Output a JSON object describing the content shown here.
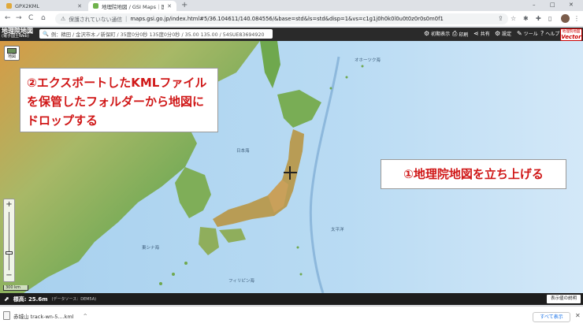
{
  "browser": {
    "tabs": [
      {
        "title": "GPX2KML",
        "active": false
      },
      {
        "title": "地理院地図 / GSI Maps｜国土地",
        "active": true
      }
    ],
    "new_tab": "+",
    "window_controls": {
      "minimize": "–",
      "restore": "□",
      "close": "✕"
    },
    "nav": {
      "back": "←",
      "forward": "→",
      "reload": "C",
      "home": "⌂"
    },
    "address": {
      "insecure_label": "保護されていない通信",
      "url": "maps.gsi.go.jp/index.html#5/36.104611/140.084556/&base=std&ls=std&disp=1&vs=c1g1j0h0k0l0u0t0z0r0s0m0f1"
    }
  },
  "app": {
    "logo_main": "地理院地図",
    "logo_sub": "(電子国土Web)",
    "search_placeholder": "例：精田 / 金沢市木ノ新保町 / 35度0分0秒 135度0分0秒 / 35.00 135.00 / 54SUE83694920",
    "header_buttons": [
      {
        "icon": "gear",
        "label": "初期表示"
      },
      {
        "icon": "printer",
        "label": "印刷"
      },
      {
        "icon": "share",
        "label": "共有"
      },
      {
        "icon": "gear",
        "label": "設定"
      },
      {
        "icon": "wrench",
        "label": "ツール"
      },
      {
        "icon": "help",
        "label": "ヘルプ"
      }
    ],
    "vector_badge": {
      "top": "地理院地図",
      "bottom": "Vector"
    },
    "layer_button": "地図"
  },
  "map": {
    "sea_labels": [
      "日本海",
      "太平洋",
      "東シナ海",
      "オホーツク海",
      "フィリピン海"
    ],
    "scale_label": "300 km",
    "zoom_in": "+",
    "zoom_out": "−"
  },
  "callouts": {
    "kml": "②エクスポートしたKMLファイルを保管したフォルダーから地図にドロップする",
    "launch": "①地理院地図を立ち上げる"
  },
  "status": {
    "elevation": "標高: 25.6m",
    "source": "(データソース：DEM5A)",
    "legend_button": "表示値の説明"
  },
  "downloads": {
    "filename": "赤城山 track-wn-5....kml",
    "show_all": "すべて表示"
  },
  "colors": {
    "header_bg": "#2a2a2a",
    "callout_text": "#d01818",
    "sea": "#b8daf2",
    "land_low": "#5fa84a",
    "land_high": "#c9a05a"
  }
}
